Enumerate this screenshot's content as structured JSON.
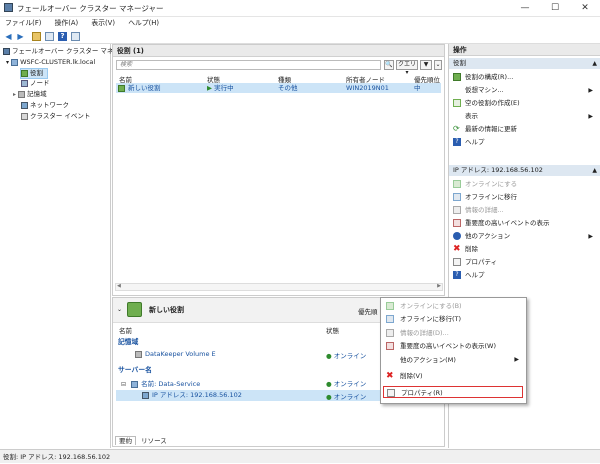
{
  "window": {
    "title": "フェールオーバー クラスター マネージャー"
  },
  "menu": [
    "ファイル(F)",
    "操作(A)",
    "表示(V)",
    "ヘルプ(H)"
  ],
  "tree": {
    "root": "フェールオーバー クラスター マネージャー",
    "cluster": "WSFC-CLUSTER.lk.local",
    "items": [
      "役割",
      "ノード",
      "記憶域",
      "ネットワーク",
      "クラスター イベント"
    ]
  },
  "roles": {
    "header": "役割 (1)",
    "search_placeholder": "検索",
    "query_label": "クエリ",
    "columns": [
      "名前",
      "状態",
      "種類",
      "所有者ノード",
      "優先順位"
    ],
    "rows": [
      {
        "name": "新しい役割",
        "state": "実行中",
        "type": "その他",
        "owner": "WIN2019N01",
        "priority": "中"
      }
    ]
  },
  "detail": {
    "title": "新しい役割",
    "priority_label": "優先順",
    "columns": [
      "名前",
      "状態"
    ],
    "groups": [
      {
        "label": "記憶域",
        "items": [
          {
            "name": "DataKeeper Volume E",
            "state": "オンライン"
          }
        ]
      },
      {
        "label": "サーバー名",
        "items": [
          {
            "name": "名前: Data-Service",
            "state": "オンライン"
          },
          {
            "name": "IP アドレス: 192.168.56.102",
            "state": "オンライン"
          }
        ]
      }
    ],
    "tabs": [
      "要約",
      "リソース"
    ]
  },
  "actions": {
    "header": "操作",
    "section1": {
      "title": "役割",
      "items": [
        "役割の構成(R)...",
        "仮想マシン...",
        "空の役割の作成(E)",
        "表示",
        "最新の情報に更新",
        "ヘルプ"
      ]
    },
    "section2": {
      "title": "IP アドレス: 192.168.56.102",
      "items": [
        "オンラインにする",
        "オフラインに移行",
        "情報の詳細...",
        "重要度の高いイベントの表示",
        "他のアクション",
        "削除",
        "プロパティ",
        "ヘルプ"
      ]
    }
  },
  "context_menu": {
    "items": [
      "オンラインにする(B)",
      "オフラインに移行(T)",
      "情報の詳細(D)...",
      "重要度の高いイベントの表示(W)",
      "他のアクション(M)",
      "削除(V)",
      "プロパティ(R)"
    ]
  },
  "status": {
    "text": "役割: IP アドレス: 192.168.56.102"
  }
}
